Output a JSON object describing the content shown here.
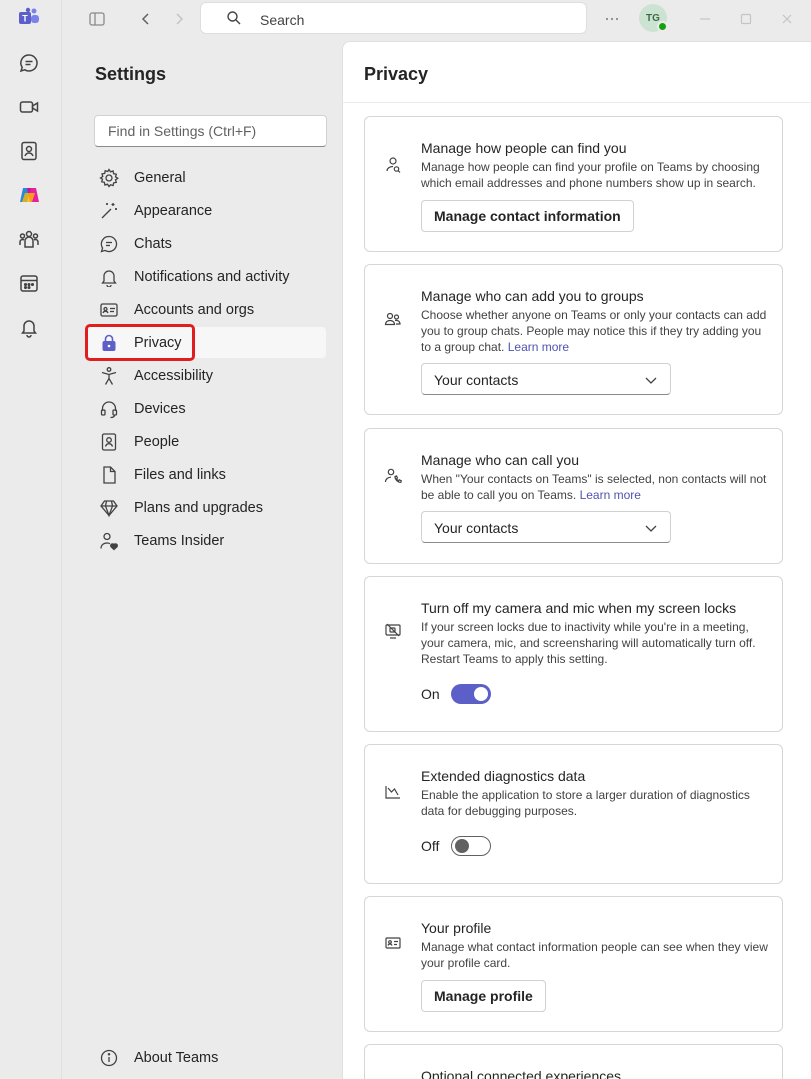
{
  "topbar": {
    "search_label": "Search",
    "avatar_initials": "TG"
  },
  "settings": {
    "title": "Settings",
    "find_placeholder": "Find in Settings (Ctrl+F)",
    "nav": [
      {
        "label": "General",
        "icon": "gear-icon"
      },
      {
        "label": "Appearance",
        "icon": "magic-wand-icon"
      },
      {
        "label": "Chats",
        "icon": "chat-icon"
      },
      {
        "label": "Notifications and activity",
        "icon": "bell-icon"
      },
      {
        "label": "Accounts and orgs",
        "icon": "id-card-icon"
      },
      {
        "label": "Privacy",
        "icon": "lock-icon",
        "selected": true
      },
      {
        "label": "Accessibility",
        "icon": "accessibility-icon"
      },
      {
        "label": "Devices",
        "icon": "headset-icon"
      },
      {
        "label": "People",
        "icon": "contact-book-icon"
      },
      {
        "label": "Files and links",
        "icon": "document-icon"
      },
      {
        "label": "Plans and upgrades",
        "icon": "diamond-icon"
      },
      {
        "label": "Teams Insider",
        "icon": "person-heart-icon"
      }
    ],
    "about": "About Teams"
  },
  "privacy": {
    "title": "Privacy",
    "find_you": {
      "title": "Manage how people can find you",
      "desc": "Manage how people can find your profile on Teams by choosing which email addresses and phone numbers show up in search.",
      "button": "Manage contact information"
    },
    "groups": {
      "title": "Manage who can add you to groups",
      "desc": "Choose whether anyone on Teams or only your contacts can add you to group chats. People may notice this if they try adding you to a group chat.",
      "link": "Learn more",
      "select_value": "Your contacts"
    },
    "call": {
      "title": "Manage who can call you",
      "desc": "When \"Your contacts on Teams\" is selected, non contacts will not be able to call you on Teams.",
      "link": "Learn more",
      "select_value": "Your contacts"
    },
    "camera": {
      "title": "Turn off my camera and mic when my screen locks",
      "desc": "If your screen locks due to inactivity while you're in a meeting, your camera, mic, and screensharing will automatically turn off. Restart Teams to apply this setting.",
      "toggle_label": "On",
      "toggle_on": true
    },
    "diagnostics": {
      "title": "Extended diagnostics data",
      "desc": "Enable the application to store a larger duration of diagnostics data for debugging purposes.",
      "toggle_label": "Off",
      "toggle_on": false
    },
    "profile": {
      "title": "Your profile",
      "desc": "Manage what contact information people can see when they view your profile card.",
      "button": "Manage profile"
    },
    "connected": {
      "title": "Optional connected experiences"
    }
  },
  "colors": {
    "accent": "#5b5fc7",
    "link": "#4f52b2",
    "highlight": "#e01e1e"
  }
}
